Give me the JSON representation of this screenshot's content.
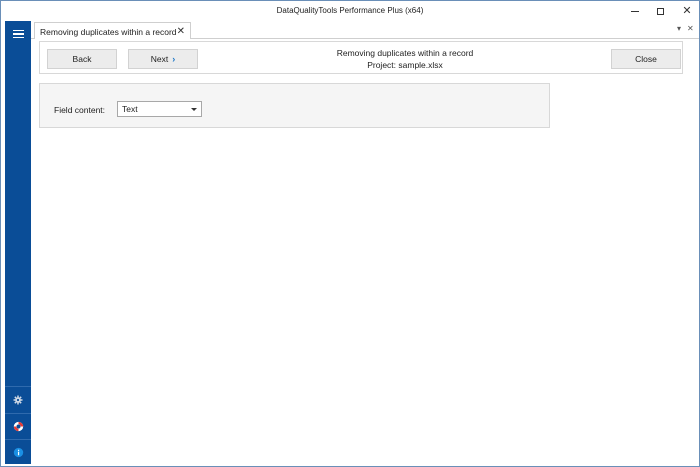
{
  "window": {
    "title": "DataQualityTools Performance Plus (x64)"
  },
  "tab": {
    "label": "Removing duplicates within a record",
    "close_symbol": "✕"
  },
  "toolbar": {
    "back_label": "Back",
    "next_label": "Next",
    "close_label": "Close",
    "heading": "Removing duplicates within a record",
    "project": "Project: sample.xlsx"
  },
  "panel": {
    "field_label": "Field content:",
    "field_value": "Text"
  },
  "sidebar": {
    "icons": [
      "menu-icon",
      "settings-icon",
      "help-lifebuoy-icon",
      "info-icon"
    ]
  },
  "colors": {
    "sidebar": "#0a4d97",
    "accent": "#1a75c7"
  }
}
